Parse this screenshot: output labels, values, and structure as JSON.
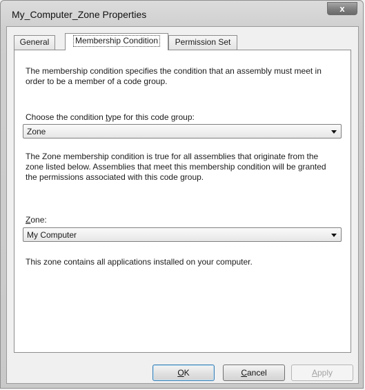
{
  "window": {
    "title": "My_Computer_Zone Properties",
    "close_label": "x"
  },
  "tabs": [
    {
      "label": "General",
      "active": false
    },
    {
      "label": "Membership Condition",
      "active": true
    },
    {
      "label": "Permission Set",
      "active": false
    }
  ],
  "panel": {
    "intro": "The membership condition specifies the condition that an assembly must meet in order to be a member of a code group.",
    "condition_label_pre": "Choose the condition ",
    "condition_label_key": "t",
    "condition_label_post": "ype for this code group:",
    "condition_value": "Zone",
    "description": "The Zone membership condition is true for all assemblies that originate from the zone listed below.  Assemblies that meet this membership condition will be granted the permissions associated with this code group.",
    "zone_label_key": "Z",
    "zone_label_post": "one:",
    "zone_value": "My Computer",
    "zone_info": "This zone contains all applications installed on your computer."
  },
  "buttons": {
    "ok_key": "O",
    "ok_rest": "K",
    "cancel_key": "C",
    "cancel_rest": "ancel",
    "apply_key": "A",
    "apply_rest": "pply"
  }
}
